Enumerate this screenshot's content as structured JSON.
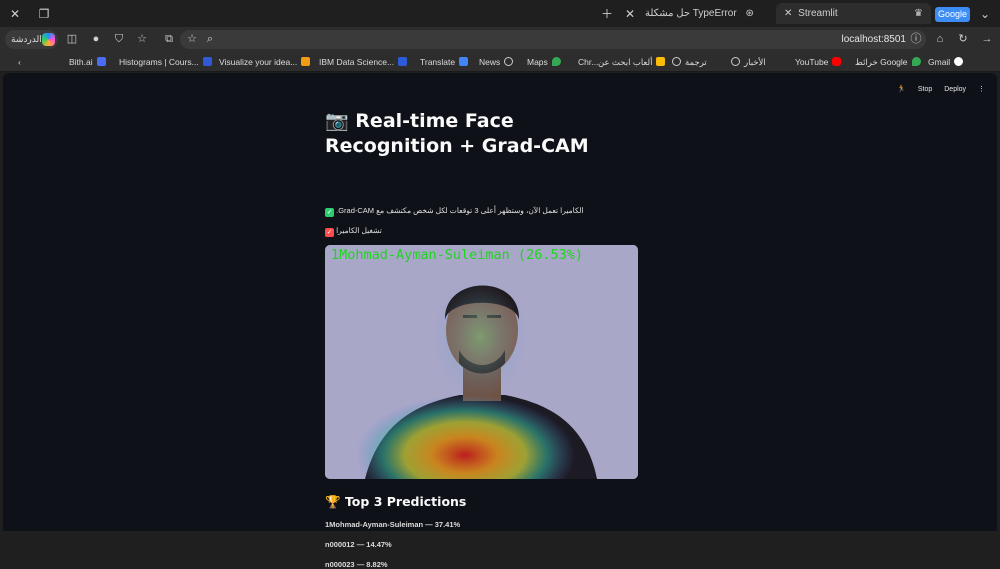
{
  "browser": {
    "tabs": [
      {
        "title": "حل مشكلة TypeError"
      },
      {
        "title": "Streamlit"
      }
    ],
    "google_button": "Google",
    "copilot_label": "الدردشة",
    "url": "localhost:8501",
    "bookmarks": [
      "Bith.ai",
      "Histograms | Cours...",
      "Visualize your idea...",
      "IBM Data Science...",
      "Translate",
      "News",
      "Maps",
      "Chr...",
      "ألعاب ابحث عن",
      "ترجمة",
      "الأخبار",
      "YouTube",
      "خرائط Google",
      "Gmail"
    ]
  },
  "streamlit": {
    "toolbar": {
      "stop": "Stop",
      "deploy": "Deploy",
      "menu": "⋮"
    },
    "title_icon": "📷",
    "title": "Real-time Face Recognition + Grad-CAM",
    "info_text": "الكاميرا تعمل الآن، وستظهر أعلى 3 توقعات لكل شخص مكتشف مع Grad-CAM.",
    "camera_toggle_label": "تشغيل الكاميرا",
    "camera_toggle_checked": true,
    "video_overlay": "1Mohmad-Ayman-Suleiman (26.53%)",
    "predictions_icon": "🏆",
    "predictions_heading": "Top 3 Predictions",
    "predictions": [
      "1Mohmad-Ayman-Suleiman — 37.41%",
      "n000012 — 14.47%",
      "n000023 — 8.82%"
    ]
  },
  "colors": {
    "app_bg": "#0e1117",
    "overlay_text": "#21d321",
    "checkbox_red": "#ff4b4b",
    "info_check_green": "#2ecc71"
  }
}
